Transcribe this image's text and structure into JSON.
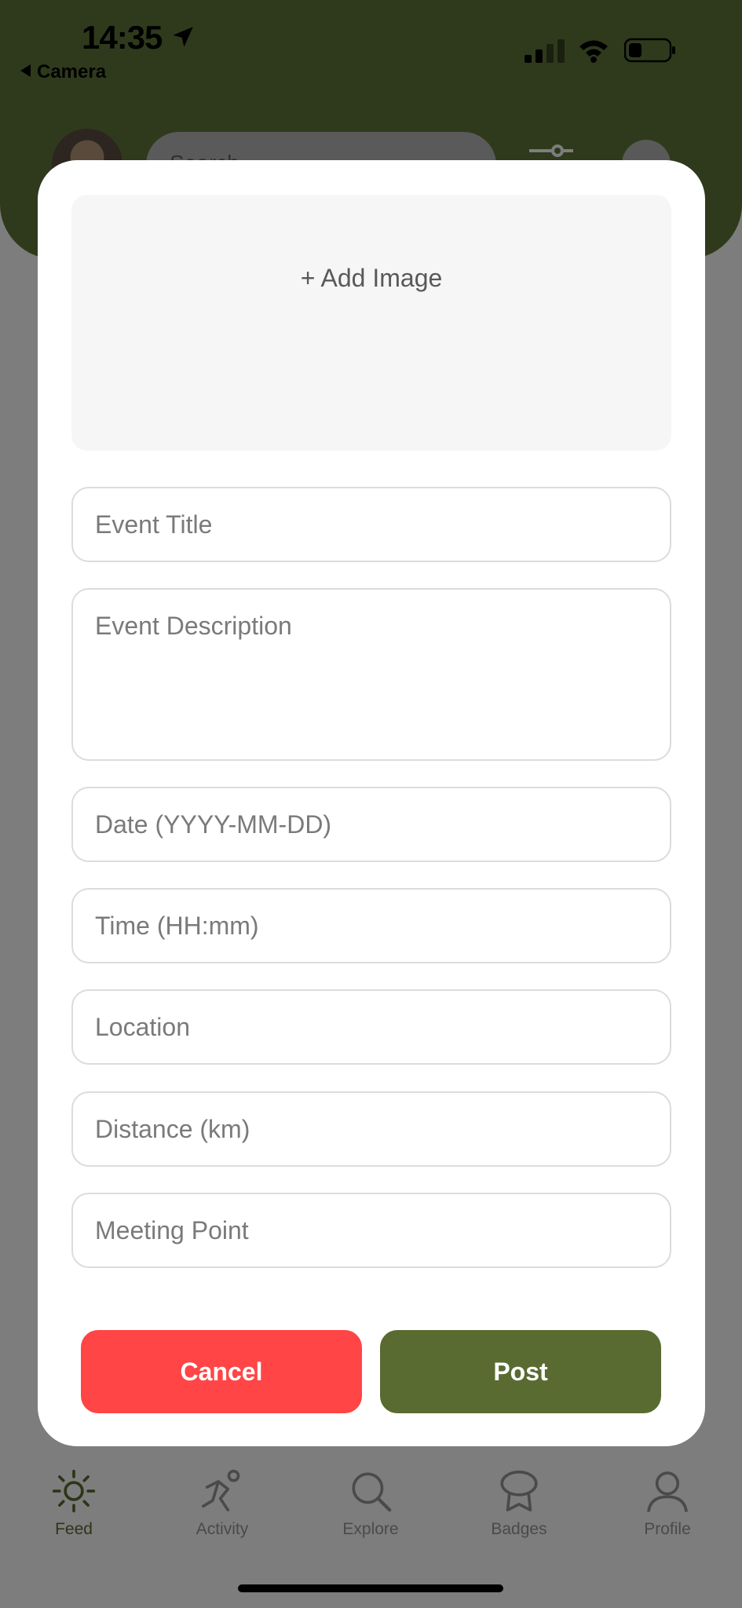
{
  "status_bar": {
    "time": "14:35",
    "back_label": "Camera"
  },
  "header": {
    "search_placeholder": "Search"
  },
  "modal": {
    "add_image_label": "+ Add Image",
    "fields": {
      "event_title": "Event Title",
      "event_description": "Event Description",
      "date": "Date (YYYY-MM-DD)",
      "time": "Time (HH:mm)",
      "location": "Location",
      "distance": "Distance (km)",
      "meeting_point": "Meeting Point"
    },
    "cancel_label": "Cancel",
    "post_label": "Post"
  },
  "tabs": [
    {
      "label": "Feed",
      "icon": "sun-icon",
      "active": true
    },
    {
      "label": "Activity",
      "icon": "runner-icon",
      "active": false
    },
    {
      "label": "Explore",
      "icon": "search-icon",
      "active": false
    },
    {
      "label": "Badges",
      "icon": "badge-icon",
      "active": false
    },
    {
      "label": "Profile",
      "icon": "person-icon",
      "active": false
    }
  ],
  "colors": {
    "accent_green": "#5a6b32",
    "cancel_red": "#ff4545",
    "header_green": "#2f3a1c"
  }
}
